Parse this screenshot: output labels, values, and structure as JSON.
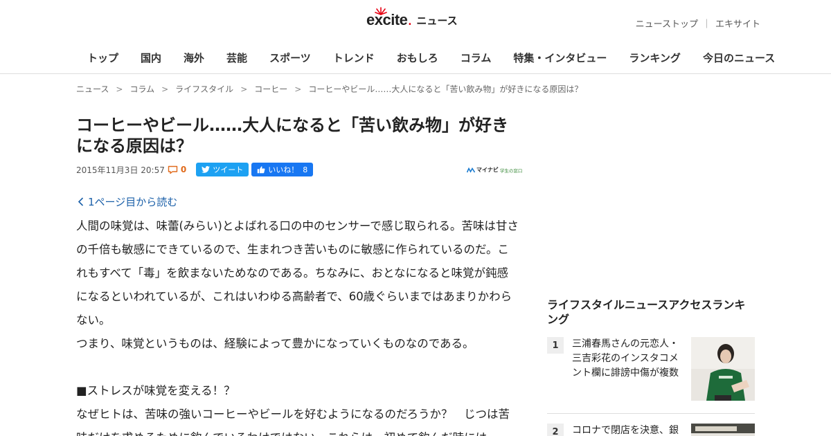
{
  "header": {
    "logo_text": "excite",
    "logo_section": "ニュース",
    "toplinks": [
      "ニューストップ",
      "エキサイト"
    ],
    "toplink_sep": "｜"
  },
  "nav": {
    "items": [
      "トップ",
      "国内",
      "海外",
      "芸能",
      "スポーツ",
      "トレンド",
      "おもしろ",
      "コラム",
      "特集・インタビュー",
      "ランキング",
      "今日のニュース"
    ]
  },
  "breadcrumb": {
    "items": [
      "ニュース",
      "コラム",
      "ライフスタイル",
      "コーヒー",
      "コーヒーやビール……大人になると「苦い飲み物」が好きになる原因は？"
    ],
    "sep": ">"
  },
  "article": {
    "title": "コーヒーやビール……大人になると「苦い飲み物」が好きになる原因は？",
    "date": "2015年11月3日 20:57",
    "comment_count": "0",
    "tweet_label": "ツイート",
    "like_label": "いいね！",
    "like_count": "8",
    "source": "マイナビ",
    "source_sub": "学生の窓口",
    "prev_link": "1ページ目から読む",
    "paragraphs": [
      "人間の味覚は、味蕾(みらい)とよばれる口の中のセンサーで感じ取られる。苦味は甘さの千倍も敏感にできているので、生まれつき苦いものに敏感に作られているのだ。これもすべて「毒」を飲まないためなのである。ちなみに、おとなになると味覚が鈍感になるといわれているが、これはいわゆる高齢者で、60歳ぐらいまではあまりかわらない。",
      "つまり、味覚というものは、経験によって豊かになっていくものなのである。",
      "■ストレスが味覚を変える！？",
      "なぜヒトは、苦味の強いコーヒーやビールを好むようになるのだろうか？　じつは苦味だけを求めるために飲んでいるわけではない。これらは、初めて飲んだ時には"
    ]
  },
  "sidebar": {
    "ranking_title": "ライフスタイルニュースアクセスランキング",
    "items": [
      {
        "rank": "1",
        "text": "三浦春馬さんの元恋人・三吉彩花のインスタコメント欄に誹謗中傷が複数"
      },
      {
        "rank": "2",
        "text": "コロナで閉店を決意、銀"
      }
    ]
  },
  "colors": {
    "link": "#1a5fa8",
    "brand_red": "#e60012",
    "twitter": "#1da1f2",
    "facebook": "#1877f2",
    "comment": "#e06a1b"
  }
}
